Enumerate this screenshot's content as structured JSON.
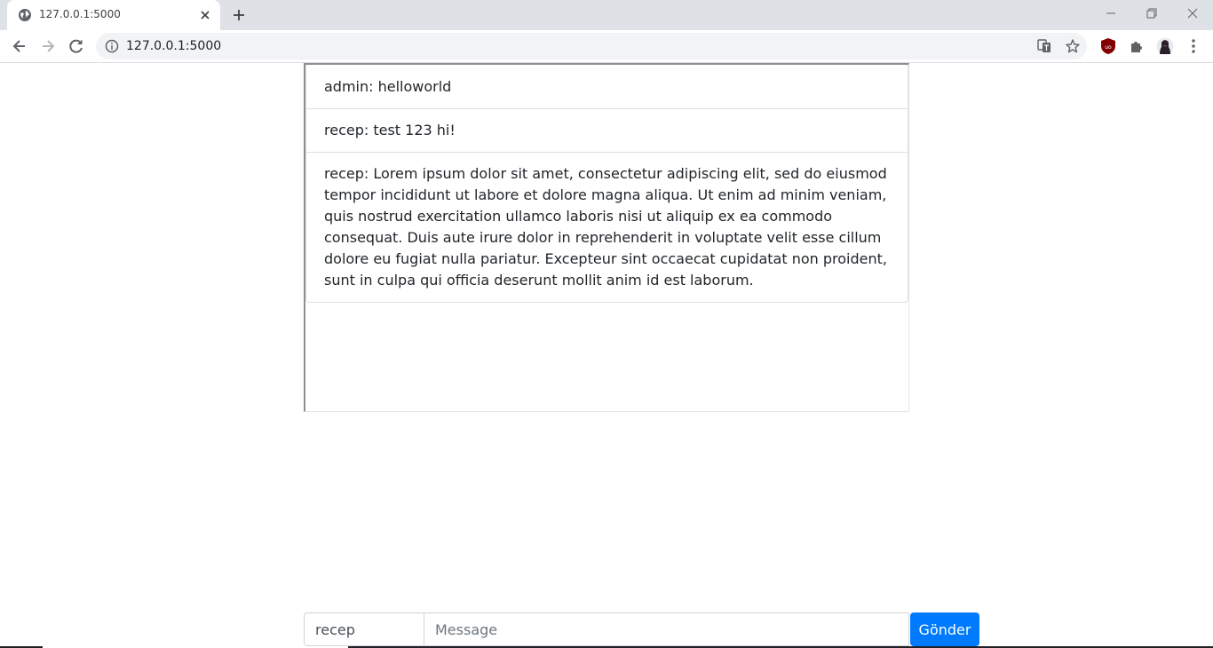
{
  "browser": {
    "tab_title": "127.0.0.1:5000",
    "url": "127.0.0.1:5000"
  },
  "chat": {
    "messages": [
      {
        "text": "admin: helloworld"
      },
      {
        "text": "recep: test 123 hi!"
      },
      {
        "text": "recep: Lorem ipsum dolor sit amet, consectetur adipiscing elit, sed do eiusmod tempor incididunt ut labore et dolore magna aliqua. Ut enim ad minim veniam, quis nostrud exercitation ullamco laboris nisi ut aliquip ex ea commodo consequat. Duis aute irure dolor in reprehenderit in voluptate velit esse cillum dolore eu fugiat nulla pariatur. Excepteur sint occaecat cupidatat non proident, sunt in culpa qui officia deserunt mollit anim id est laborum."
      }
    ]
  },
  "form": {
    "username_value": "recep",
    "message_placeholder": "Message",
    "send_label": "Gönder"
  },
  "colors": {
    "primary": "#007bff",
    "chrome_tabstrip": "#dee1e6",
    "omnibox": "#f1f3f4"
  }
}
